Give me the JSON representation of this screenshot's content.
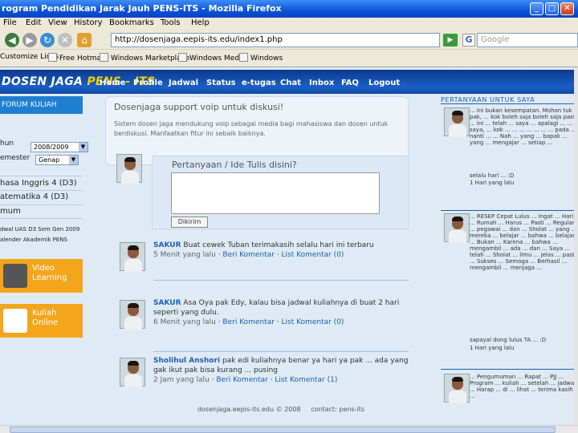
{
  "window": {
    "title": "rogram Pendidikan Jarak Jauh PENS-ITS - Mozilla Firefox",
    "buttons": {
      "minimize": "_",
      "maximize": "□",
      "close": "✕"
    }
  },
  "menu": [
    "File",
    "Edit",
    "View",
    "History",
    "Bookmarks",
    "Tools",
    "Help"
  ],
  "toolbar": {
    "url": "http://dosenjaga.eepis-its.edu/index1.php",
    "search_placeholder": "Google",
    "go_label": "▶",
    "google_icon": "G"
  },
  "bookmarks": [
    "Customize Links",
    "Free Hotmail",
    "Windows Marketplace",
    "Windows Media",
    "Windows"
  ],
  "site": {
    "logo_a": "DOSEN JAGA",
    "logo_b": "PENS - ITS",
    "nav": [
      "Home",
      "Profile",
      "Jadwal",
      "Status",
      "e-tugas",
      "Chat",
      "Inbox",
      "FAQ",
      "Logout"
    ],
    "left": {
      "title": "FORUM KULIAH",
      "tahun_label": "hun",
      "tahun_value": "2008/2009",
      "semester_label": "emester",
      "semester_value": "Genap",
      "courses": [
        "hasa Inggris 4 (D3)",
        "atematika 4 (D3)"
      ],
      "umum": "mum",
      "info1": "dwal UAS D3 Sem Gen 2009",
      "info2": "alender Akademik PENS",
      "promo1": [
        "Video",
        "Learning"
      ],
      "promo2": [
        "Kuliah",
        "Online"
      ]
    },
    "center": {
      "support_title": "Dosenjaga support voip untuk diskusi!",
      "support_text": "Sistem dosen jaga mendukung voip sebagai media bagi mahasiswa dan dosen untuk berdiskusi. Manfaatkan fitur ini sebaik baiknya.",
      "ask_title": "Pertanyaan / Ide Tulis disini?",
      "ask_button": "Dikirim",
      "posts": [
        {
          "user": "SAKUR",
          "message": "Buat cewek Tuban terimakasih selalu hari ini terbaru",
          "meta": "5 Menit yang lalu",
          "comment": "Beri Komentar",
          "list": "List Komentar (0)"
        },
        {
          "user": "SAKUR",
          "message": "Asa Oya pak Edy, kalau bisa jadwal kuliahnya di buat 2 hari seperti yang dulu.",
          "meta": "6 Menit yang lalu",
          "comment": "Beri Komentar",
          "list": "List Komentar (0)"
        },
        {
          "user": "Sholihul Anshori",
          "message": "pak edi kuliahnya benar ya hari ya pak ... ada yang gak ikut pak bisa kurang ... pusing",
          "meta": "2 Jam yang lalu",
          "comment": "Beri Komentar",
          "list": "List Komentar (1)"
        }
      ],
      "footer_left": "dosenjaga.eepis-its.edu © 2008",
      "footer_right": "contact: pens-its"
    },
    "right": {
      "title": "PERTANYAAN UNTUK SAYA",
      "q1_text": "... ini bukan kesempatan. Mohon tuk pak, ... kok boleh saja boleh saja pasti ... ini ... telah ... saya ... apalagi ... ... saya, ... kok ... ... ... ... ... ... ... pada ... nanti ... ... Nah ... yang ... bapak ... yang ... mengajar ... setiap ...",
      "q1_meta": "selalu hari ... :D",
      "q1_time": "1 Hari yang lalu",
      "q2_text": "... RESEP Cepat Lulus ... Ingat ... Hari ... Rumah ... Harus ... Pasti ... Regular ... pegawai ... dan ... Sholat ... yang ... mereka ... belajar ... bahwa ... belajar ... Bukan ... Karena ... bahwa ... mengambil ... ada ... dan ... Saya ... telah ... Sholat ... Ilmu ... jelas ... pasti ... Sukses ... Semoga ... Berhasil ... mengambil ... menjaga ...",
      "q2_meta": "sapayal dong lulus TA ... :D",
      "q2_time": "1 Hari yang lalu",
      "q3_text": "... Pengumuman ... Rapat ... PJJ ... Program ... kuliah ... setelah ... jadwal ... Harap ... di ... lihat ... terima kasih ...",
      "q3_meta": ""
    }
  },
  "colors": {
    "accent": "#1e5fb0",
    "promo": "#f3a51b",
    "navbar": "#1a5fc4"
  }
}
